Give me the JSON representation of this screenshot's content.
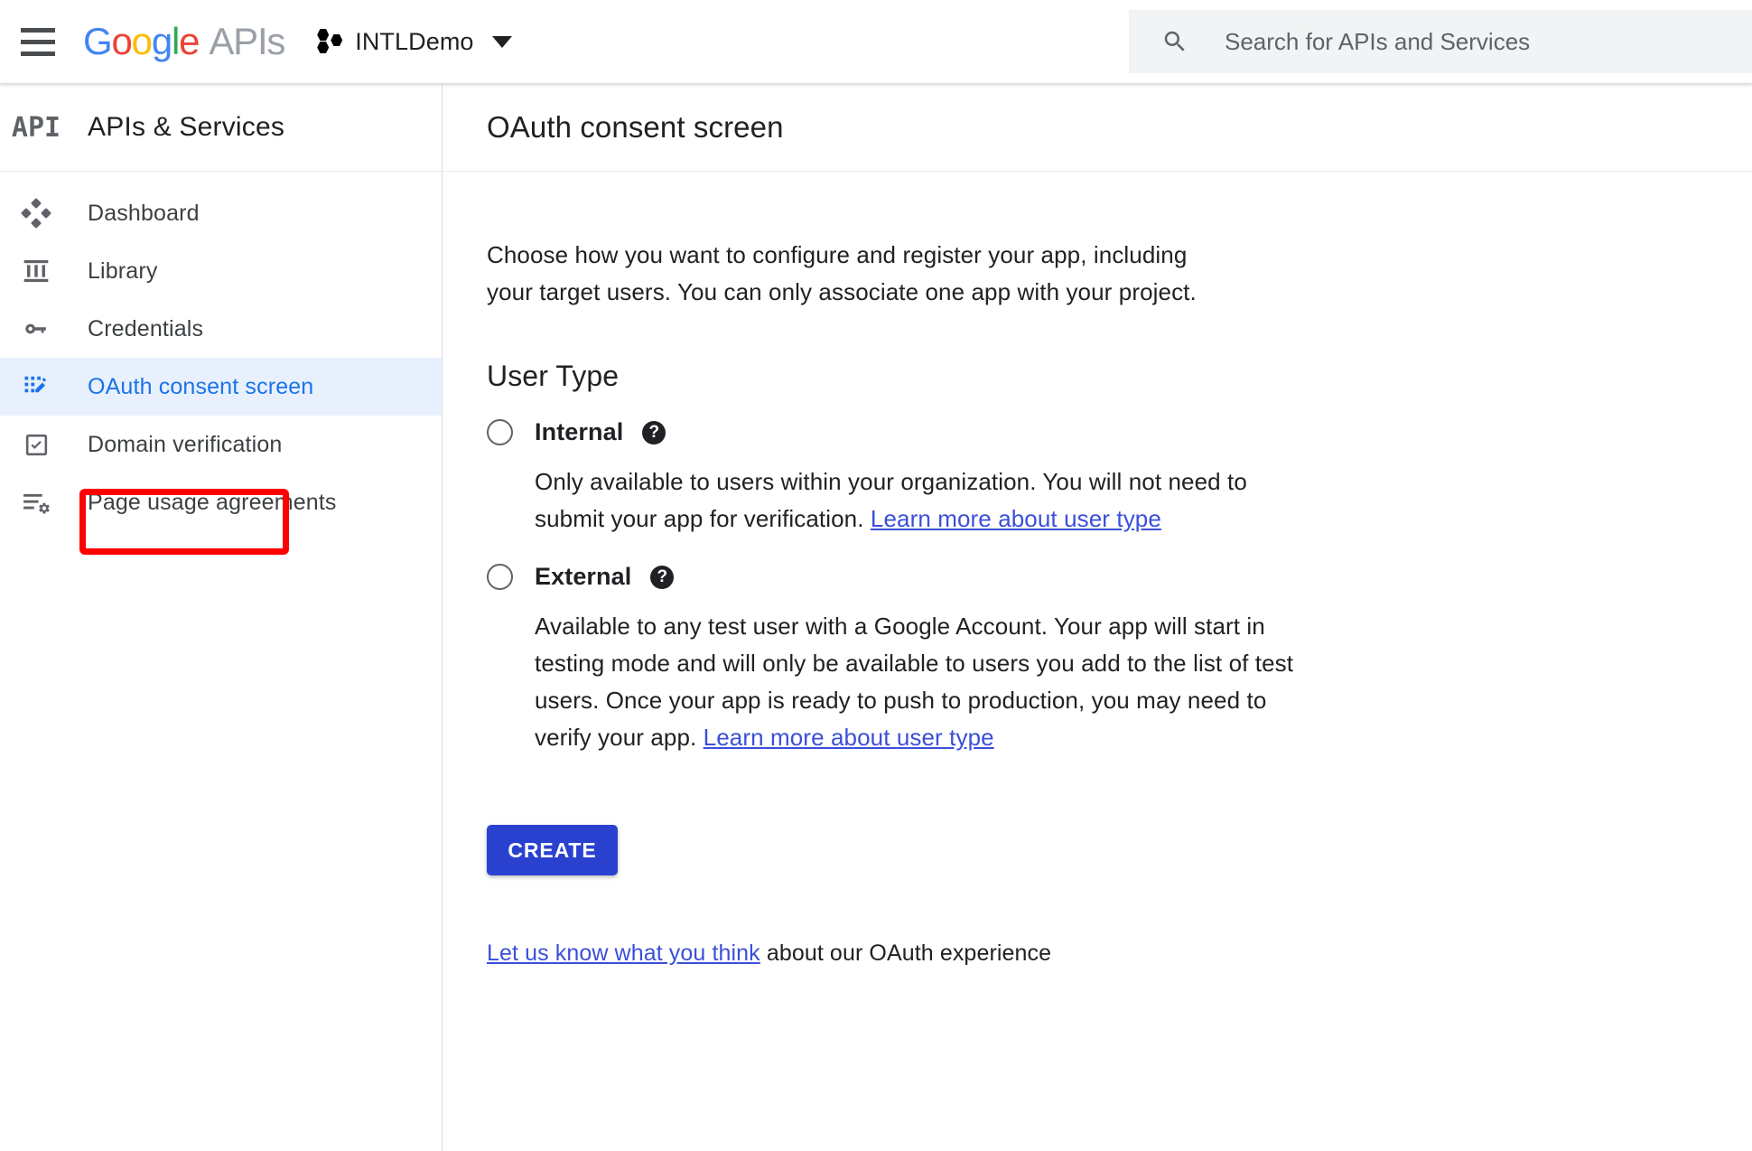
{
  "topbar": {
    "menu_icon": "hamburger-menu-icon",
    "logo_text": "Google",
    "logo_suffix": "APIs",
    "project_icon": "project-hexagons-icon",
    "project_name": "INTLDemo",
    "project_caret": "chevron-down-icon",
    "search": {
      "icon": "search-icon",
      "placeholder": "Search for APIs and Services",
      "value": ""
    }
  },
  "sidebar": {
    "logo_badge": "API",
    "title": "APIs & Services",
    "items": [
      {
        "label": "Dashboard",
        "icon": "dashboard-icon",
        "active": false
      },
      {
        "label": "Library",
        "icon": "library-icon",
        "active": false
      },
      {
        "label": "Credentials",
        "icon": "key-icon",
        "active": false
      },
      {
        "label": "OAuth consent screen",
        "icon": "consent-screen-icon",
        "active": true
      },
      {
        "label": "Domain verification",
        "icon": "checkbox-icon",
        "active": false
      },
      {
        "label": "Page usage agreements",
        "icon": "list-gear-icon",
        "active": false
      }
    ],
    "highlight_color": "#ff0000",
    "active_bg_color": "#e8f0fe",
    "active_text_color": "#1a73e8"
  },
  "main": {
    "page_title": "OAuth consent screen",
    "intro": "Choose how you want to configure and register your app, including your target users. You can only associate one app with your project.",
    "section_heading": "User Type",
    "options": [
      {
        "label": "Internal",
        "help_icon": "help-circle-icon",
        "selected": false,
        "desc_before_link": "Only available to users within your organization. You will not need to submit your app for verification. ",
        "link_text": "Learn more about user type",
        "desc_after_link": ""
      },
      {
        "label": "External",
        "help_icon": "help-circle-icon",
        "selected": false,
        "desc_before_link": "Available to any test user with a Google Account. Your app will start in testing mode and will only be available to users you add to the list of test users. Once your app is ready to push to production, you may need to verify your app. ",
        "link_text": "Learn more about user type",
        "desc_after_link": ""
      }
    ],
    "create_button": "CREATE",
    "create_button_color": "#2a41d0",
    "footer_link_text": "Let us know what you think",
    "footer_rest_text": " about our OAuth experience"
  }
}
